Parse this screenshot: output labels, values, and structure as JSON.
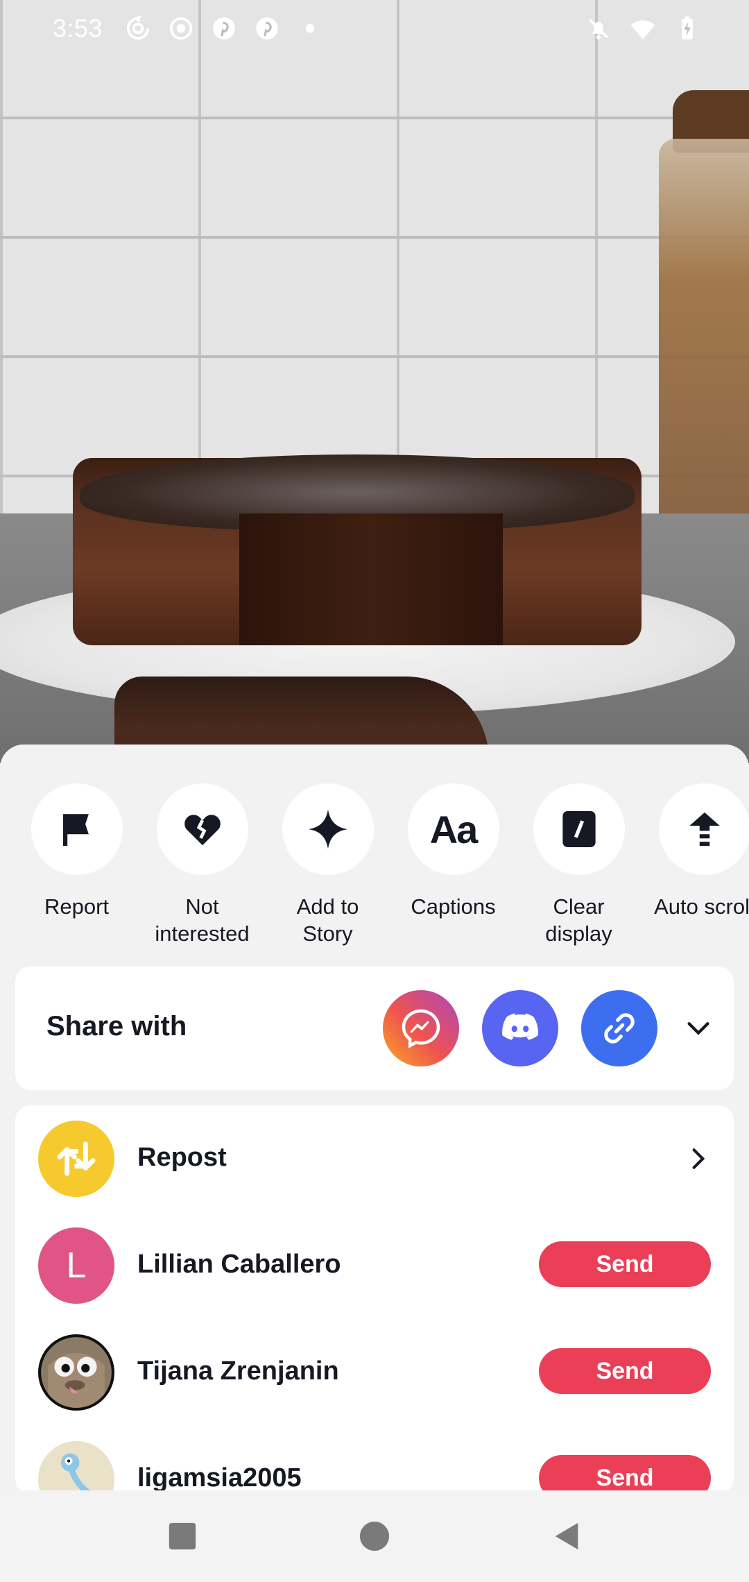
{
  "status_bar": {
    "time": "3:53",
    "left_icons": [
      "sync-icon",
      "record-icon",
      "pinterest-icon",
      "pinterest-icon",
      "dot-icon"
    ],
    "right_icons": [
      "notifications-off-icon",
      "wifi-icon",
      "battery-charging-icon"
    ]
  },
  "actions": [
    {
      "icon": "flag-icon",
      "label": "Report"
    },
    {
      "icon": "broken-heart-icon",
      "label": "Not\ninterested"
    },
    {
      "icon": "sparkle-icon",
      "label": "Add to\nStory"
    },
    {
      "icon": "captions-icon",
      "label": "Captions"
    },
    {
      "icon": "clear-display-icon",
      "label": "Clear\ndisplay"
    },
    {
      "icon": "auto-scroll-icon",
      "label": "Auto scroll"
    }
  ],
  "share": {
    "title": "Share with",
    "apps": [
      "messenger-icon",
      "discord-icon",
      "copy-link-icon"
    ],
    "expand_icon": "chevron-down-icon"
  },
  "list": {
    "repost_label": "Repost",
    "contacts": [
      {
        "name": "Lillian Caballero",
        "initial": "L",
        "avatar_color": "#e05585",
        "button": "Send"
      },
      {
        "name": "Tijana Zrenjanin",
        "initial": "",
        "avatar_color": "#3a3a3a",
        "button": "Send"
      },
      {
        "name": "ligamsia2005",
        "initial": "",
        "avatar_color": "#e9e2c8",
        "button": "Send"
      }
    ]
  },
  "colors": {
    "send_button": "#ea3f57",
    "repost_icon_bg": "#f6c92e",
    "discord": "#5865f2",
    "copy_link": "#3e6ef0"
  },
  "nav": {
    "icons": [
      "recents-square-icon",
      "home-circle-icon",
      "back-triangle-icon"
    ]
  }
}
